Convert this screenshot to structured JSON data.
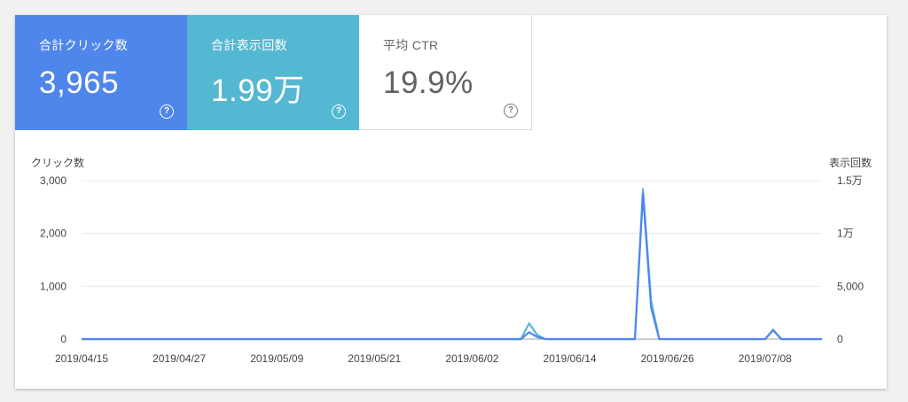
{
  "metrics": [
    {
      "label": "合計クリック数",
      "value": "3,965",
      "color": "#4f86ec"
    },
    {
      "label": "合計表示回数",
      "value": "1.99万",
      "color": "#55b8d2"
    },
    {
      "label": "平均 CTR",
      "value": "19.9%"
    }
  ],
  "help_icon": "question-circle-icon",
  "chart_data": {
    "type": "line",
    "left_axis_title": "クリック数",
    "right_axis_title": "表示回数",
    "yticks_left": [
      {
        "v": 3000,
        "label": "3,000"
      },
      {
        "v": 2000,
        "label": "2,000"
      },
      {
        "v": 1000,
        "label": "1,000"
      },
      {
        "v": 0,
        "label": "0"
      }
    ],
    "yticks_right": [
      {
        "label": "1.5万"
      },
      {
        "label": "1万"
      },
      {
        "label": "5,000"
      },
      {
        "label": "0"
      }
    ],
    "ylim_left": [
      0,
      3000
    ],
    "ylim_right": [
      0,
      15000
    ],
    "x_ticks": [
      "2019/04/15",
      "2019/04/27",
      "2019/05/09",
      "2019/05/21",
      "2019/06/02",
      "2019/06/14",
      "2019/06/26",
      "2019/07/08"
    ],
    "x_start": "2019/04/15",
    "days": 91,
    "grid": true,
    "series": [
      {
        "color": "#4f86ec",
        "axis": "left",
        "points": [
          [
            54,
            0
          ],
          [
            55,
            130
          ],
          [
            56,
            40
          ],
          [
            57,
            0
          ],
          [
            68,
            0
          ],
          [
            69,
            2750
          ],
          [
            70,
            600
          ],
          [
            71,
            0
          ],
          [
            84,
            0
          ],
          [
            85,
            170
          ],
          [
            86,
            0
          ]
        ]
      },
      {
        "color": "#55b8d2",
        "axis": "right",
        "points": [
          [
            54,
            0
          ],
          [
            55,
            1500
          ],
          [
            56,
            400
          ],
          [
            57,
            0
          ],
          [
            68,
            0
          ],
          [
            69,
            14200
          ],
          [
            70,
            3600
          ],
          [
            71,
            0
          ],
          [
            84,
            0
          ],
          [
            85,
            900
          ],
          [
            86,
            0
          ]
        ]
      }
    ]
  }
}
